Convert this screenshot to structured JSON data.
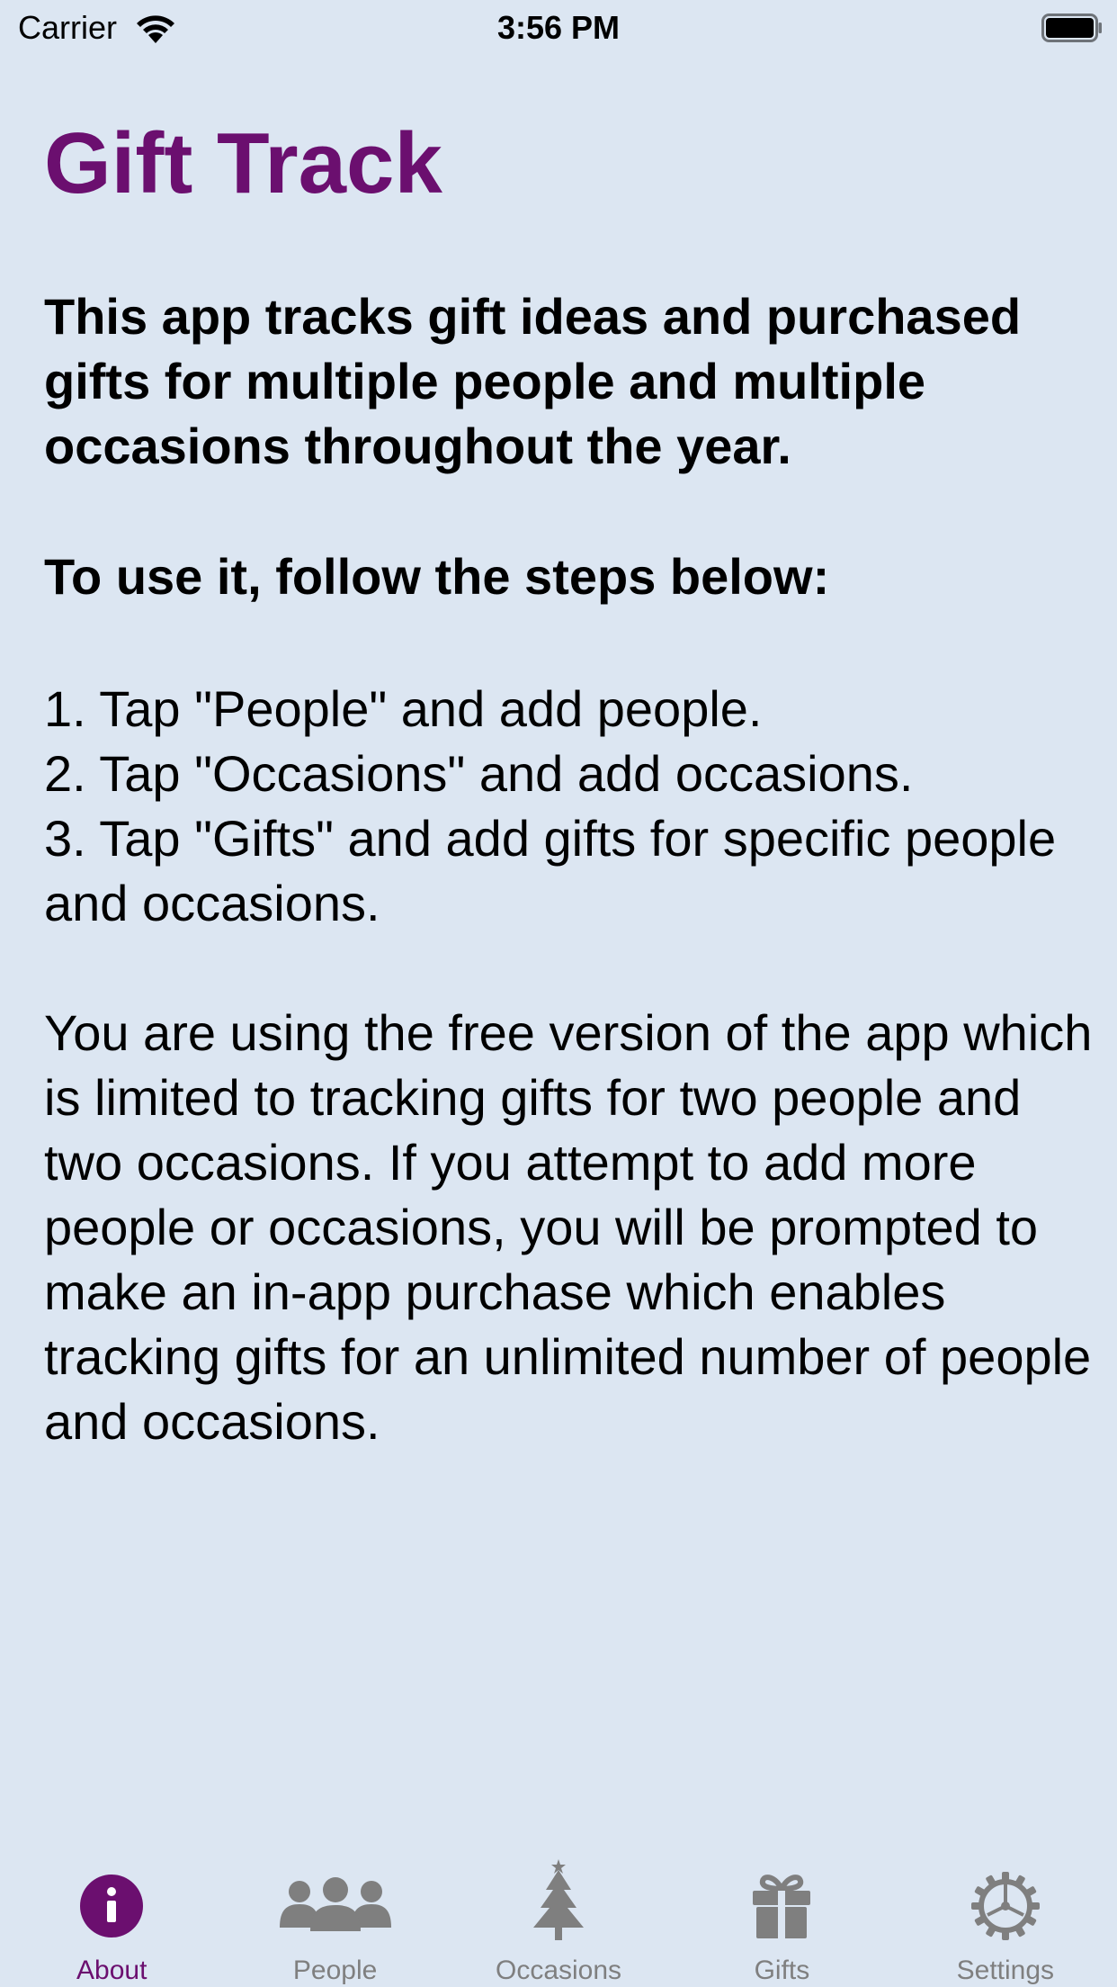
{
  "status_bar": {
    "carrier": "Carrier",
    "time": "3:56 PM"
  },
  "app": {
    "title": "Gift Track",
    "intro": "This app tracks gift ideas and purchased gifts for multiple people and multiple occasions throughout the year.",
    "steps_heading": "To use it, follow the steps below:",
    "steps": [
      "1. Tap \"People\" and add people.",
      "2. Tap \"Occasions\" and add occasions.",
      "3. Tap \"Gifts\" and add gifts for specific people and occasions."
    ],
    "notice": "You are using the free version of the app which is limited to tracking gifts for two people and two occasions. If you attempt to add more people or occasions, you will be prompted to make an in-app purchase which enables tracking gifts for an unlimited number of people and occasions."
  },
  "tab_bar": {
    "active": "About",
    "tabs": [
      {
        "label": "About",
        "icon": "info-icon"
      },
      {
        "label": "People",
        "icon": "people-icon"
      },
      {
        "label": "Occasions",
        "icon": "tree-icon"
      },
      {
        "label": "Gifts",
        "icon": "gift-icon"
      },
      {
        "label": "Settings",
        "icon": "gear-icon"
      }
    ]
  },
  "colors": {
    "background": "#dce6f2",
    "accent": "#6b0f6f",
    "inactive_tab": "#7f7f7f"
  }
}
